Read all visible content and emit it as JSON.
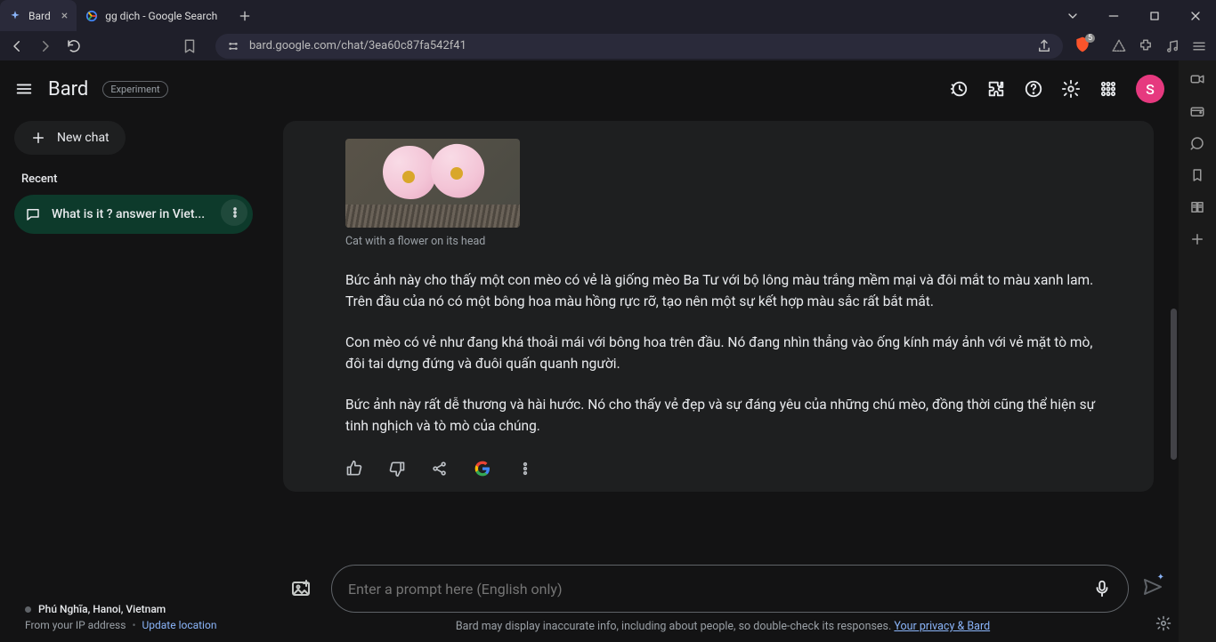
{
  "browser": {
    "tabs": [
      {
        "title": "Bard",
        "active": true
      },
      {
        "title": "gg dịch - Google Search",
        "active": false
      }
    ],
    "url": "bard.google.com/chat/3ea60c87fa542f41",
    "shield_badge": "5"
  },
  "header": {
    "brand": "Bard",
    "experiment_label": "Experiment",
    "avatar_letter": "S"
  },
  "sidebar": {
    "new_chat_label": "New chat",
    "recent_label": "Recent",
    "chats": [
      {
        "title": "What is it ? answer in Viet..."
      }
    ],
    "footer": {
      "location": "Phú Nghĩa, Hanoi, Vietnam",
      "from_ip": "From your IP address",
      "update_location": "Update location"
    }
  },
  "message": {
    "image_caption": "Cat with a flower on its head",
    "paragraphs": [
      "Bức ảnh này cho thấy một con mèo có vẻ là giống mèo Ba Tư với bộ lông màu trắng mềm mại và đôi mắt to màu xanh lam. Trên đầu của nó có một bông hoa màu hồng rực rỡ, tạo nên một sự kết hợp màu sắc rất bắt mắt.",
      "Con mèo có vẻ như đang khá thoải mái với bông hoa trên đầu. Nó đang nhìn thẳng vào ống kính máy ảnh với vẻ mặt tò mò, đôi tai dựng đứng và đuôi quấn quanh người.",
      "Bức ảnh này rất dễ thương và hài hước. Nó cho thấy vẻ đẹp và sự đáng yêu của những chú mèo, đồng thời cũng thể hiện sự tinh nghịch và tò mò của chúng."
    ]
  },
  "prompt": {
    "placeholder": "Enter a prompt here (English only)"
  },
  "disclaimer": {
    "text": "Bard may display inaccurate info, including about people, so double-check its responses. ",
    "link_text": "Your privacy & Bard"
  }
}
